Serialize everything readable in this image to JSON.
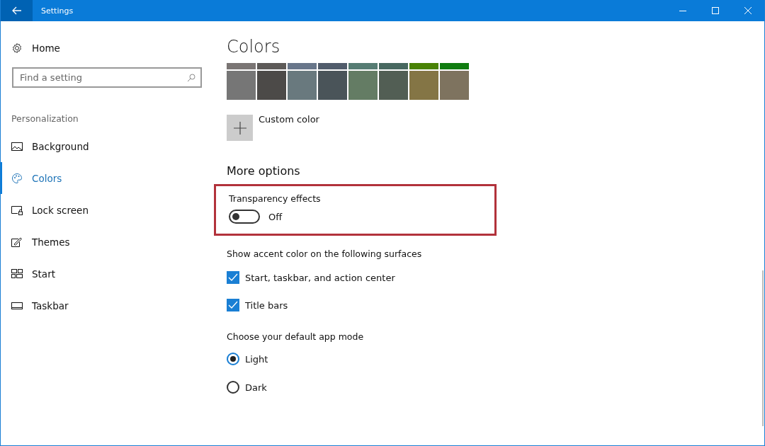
{
  "window": {
    "title": "Settings"
  },
  "sidebar": {
    "home": "Home",
    "search": {
      "placeholder": "Find a setting"
    },
    "section": "Personalization",
    "items": [
      {
        "label": "Background",
        "kind": "picture",
        "selected": false
      },
      {
        "label": "Colors",
        "kind": "palette",
        "selected": true
      },
      {
        "label": "Lock screen",
        "kind": "lock",
        "selected": false
      },
      {
        "label": "Themes",
        "kind": "brush",
        "selected": false
      },
      {
        "label": "Start",
        "kind": "tiles",
        "selected": false
      },
      {
        "label": "Taskbar",
        "kind": "taskbar",
        "selected": false
      }
    ]
  },
  "content": {
    "title": "Colors",
    "swatch_rows": [
      [
        {
          "color": "#7a7574"
        },
        {
          "color": "#5d5a58"
        },
        {
          "color": "#68768a"
        },
        {
          "color": "#515c6b"
        },
        {
          "color": "#567c73"
        },
        {
          "color": "#486860"
        },
        {
          "color": "#498205"
        },
        {
          "color": "#107c10"
        }
      ],
      [
        {
          "color": "#767676"
        },
        {
          "color": "#4c4a48"
        },
        {
          "color": "#69797e"
        },
        {
          "color": "#4a5459"
        },
        {
          "color": "#647c64"
        },
        {
          "color": "#525e54"
        },
        {
          "color": "#847545"
        },
        {
          "color": "#7e735f"
        }
      ]
    ],
    "custom_color": "Custom color",
    "more_options": "More options",
    "transparency": {
      "label": "Transparency effects",
      "on": false,
      "state_text": "Off",
      "highlighted": true
    },
    "accent_heading": "Show accent color on the following surfaces",
    "accent_options": [
      {
        "label": "Start, taskbar, and action center",
        "checked": true
      },
      {
        "label": "Title bars",
        "checked": true
      }
    ],
    "mode_heading": "Choose your default app mode",
    "modes": [
      {
        "label": "Light",
        "selected": true
      },
      {
        "label": "Dark",
        "selected": false
      }
    ]
  }
}
